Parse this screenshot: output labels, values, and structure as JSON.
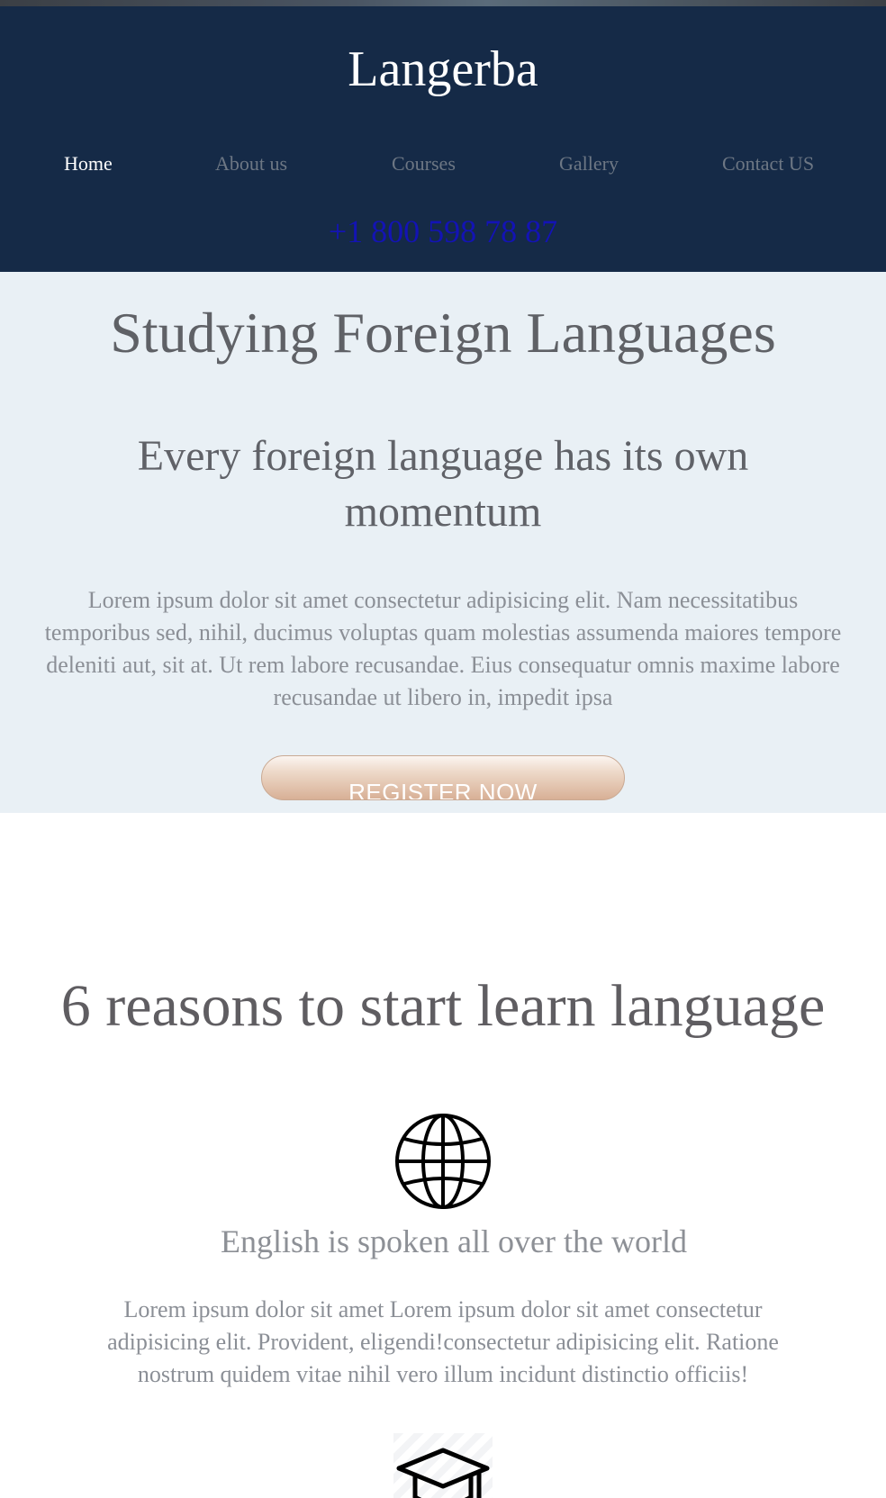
{
  "brand": {
    "name": "Langerba"
  },
  "nav": {
    "items": [
      {
        "label": "Home",
        "active": true
      },
      {
        "label": "About us",
        "active": false
      },
      {
        "label": "Courses",
        "active": false
      },
      {
        "label": "Gallery",
        "active": false
      },
      {
        "label": "Contact US",
        "active": false
      }
    ]
  },
  "contact": {
    "phone": "+1 800 598 78 87"
  },
  "hero": {
    "title": "Studying Foreign Languages",
    "subtitle": "Every foreign language has its own momentum",
    "body": "Lorem ipsum dolor sit amet consectetur adipisicing elit. Nam necessitatibus temporibus sed, nihil, ducimus voluptas quam molestias assumenda maiores tempore deleniti aut, sit at. Ut rem labore recusandae. Eius consequatur omnis maxime labore recusandae ut libero in, impedit ipsa",
    "cta_label": "REGISTER NOW"
  },
  "reasons": {
    "title": "6 reasons to start learn language",
    "items": [
      {
        "icon": "globe-icon",
        "title": "English is spoken all over the world",
        "body": "Lorem ipsum dolor sit amet Lorem ipsum dolor sit amet consectetur adipisicing elit. Provident, eligendi!consectetur adipisicing elit. Ratione nostrum quidem vitae nihil vero illum incidunt distinctio officiis!"
      },
      {
        "icon": "graduation-cap-icon"
      }
    ]
  },
  "colors": {
    "header_bg": "#152a47",
    "hero_bg": "#e9f0f5",
    "nav_active": "#ffffff",
    "nav_inactive": "#6d7784",
    "phone": "#1313b5",
    "cta_accent": "#d8b096"
  }
}
